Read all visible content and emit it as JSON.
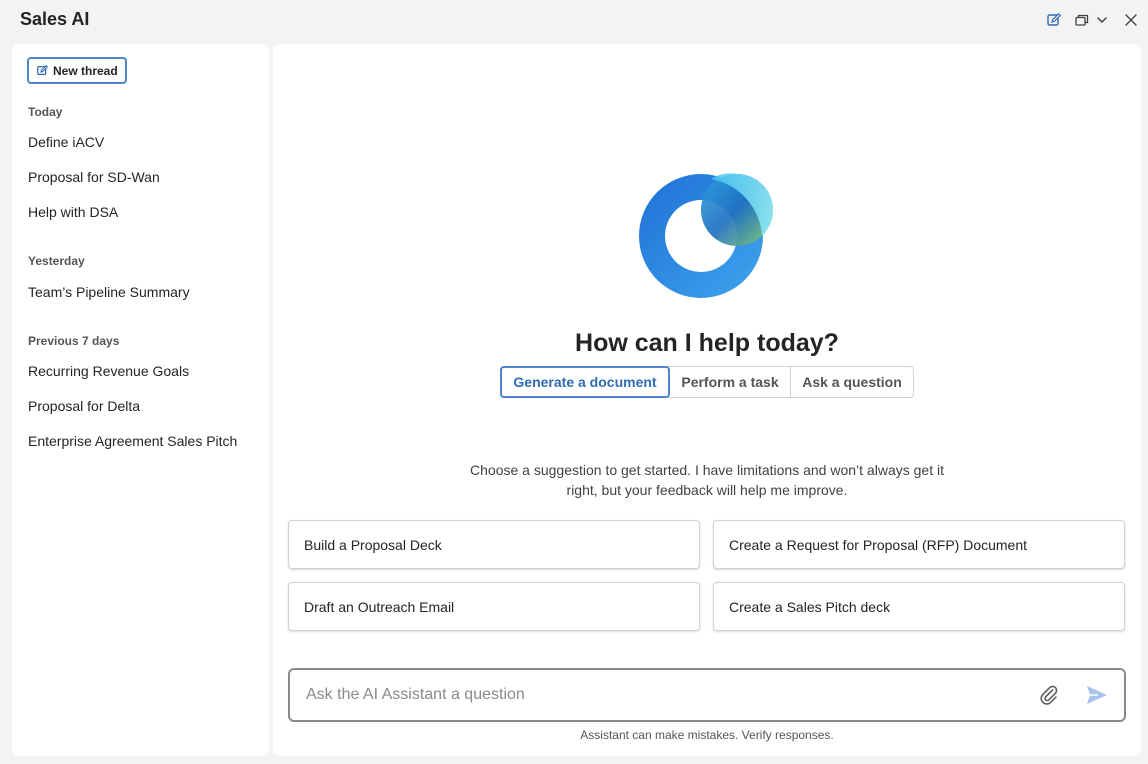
{
  "app": {
    "title": "Sales AI"
  },
  "sidebar": {
    "new_thread_label": "New thread",
    "sections": [
      {
        "label": "Today",
        "items": [
          "Define iACV",
          "Proposal for SD-Wan",
          "Help with DSA"
        ]
      },
      {
        "label": "Yesterday",
        "items": [
          "Team’s Pipeline Summary"
        ]
      },
      {
        "label": "Previous 7 days",
        "items": [
          "Recurring Revenue Goals",
          "Proposal for Delta",
          "Enterprise Agreement Sales Pitch"
        ]
      }
    ]
  },
  "main": {
    "heading": "How can I help today?",
    "tabs": [
      {
        "label": "Generate a document",
        "active": true
      },
      {
        "label": "Perform a task",
        "active": false
      },
      {
        "label": "Ask a question",
        "active": false
      }
    ],
    "intro_line1": "Choose a suggestion to get started. I have limitations and won’t always get it",
    "intro_line2": "right, but your feedback will help me improve.",
    "suggestions": [
      "Build a Proposal Deck",
      "Create a Request for Proposal (RFP) Document",
      "Draft an Outreach Email",
      "Create a Sales Pitch deck"
    ],
    "composer": {
      "placeholder": "Ask the AI Assistant a question",
      "value": ""
    },
    "disclaimer": "Assistant can make mistakes. Verify responses."
  },
  "icons": {
    "compose": "compose-icon",
    "window": "window-restore-icon",
    "chevron": "chevron-down-icon",
    "close": "close-icon",
    "attach": "paperclip-icon",
    "send": "send-icon"
  },
  "colors": {
    "accent": "#4c87c9",
    "send": "#a8c4ec"
  }
}
